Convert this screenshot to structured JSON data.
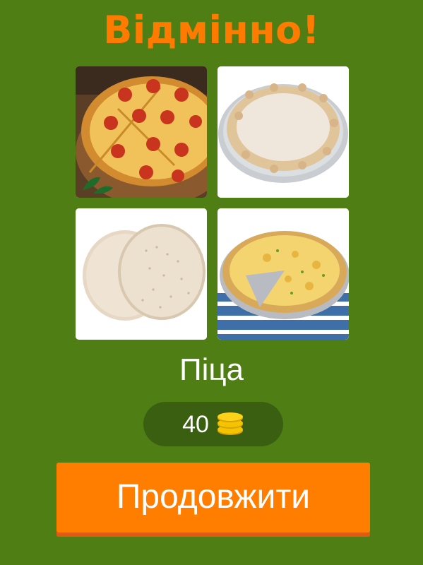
{
  "header": {
    "title": "Відмінно!"
  },
  "puzzle": {
    "tiles": [
      {
        "icon": "pepperoni-pizza-image"
      },
      {
        "icon": "pizza-crust-on-pan-image"
      },
      {
        "icon": "pizza-dough-bases-image"
      },
      {
        "icon": "cheese-pizza-sliced-image"
      }
    ],
    "answer": "Піца"
  },
  "reward": {
    "coins": "40",
    "icon": "coins-icon"
  },
  "actions": {
    "continue_label": "Продовжити"
  },
  "colors": {
    "background": "#4f7f14",
    "accent": "#ff7b00",
    "pill": "#3a5f10",
    "coin": "#f5c400"
  }
}
